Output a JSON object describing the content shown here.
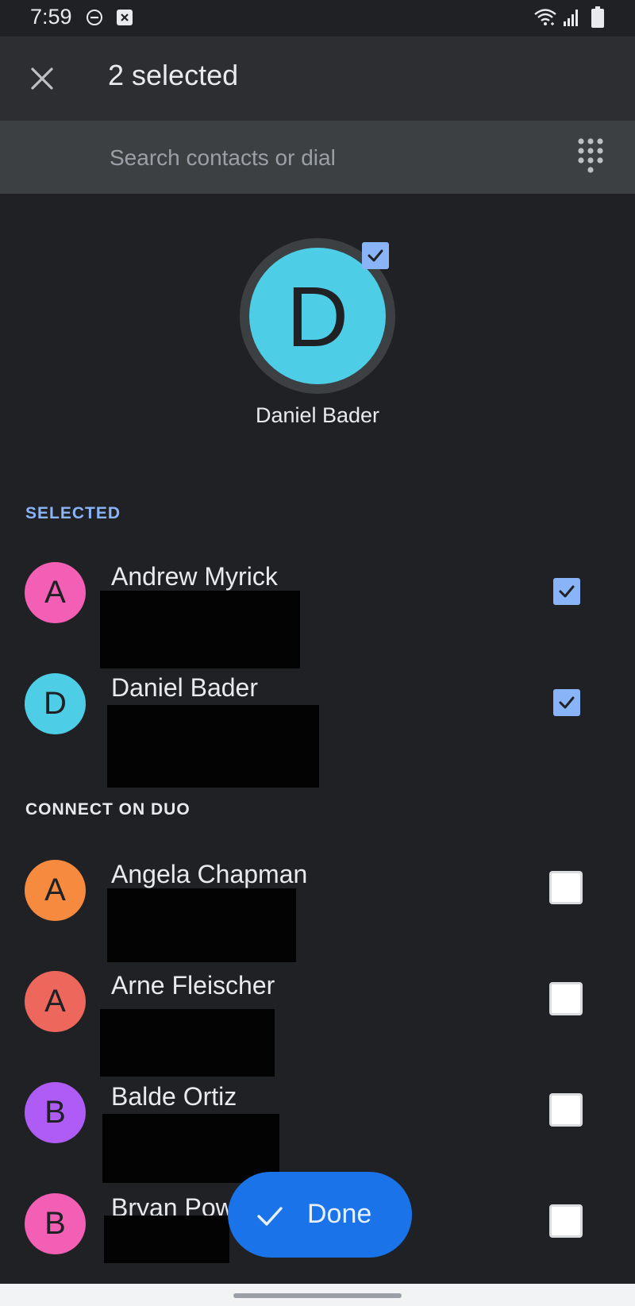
{
  "status_bar": {
    "time": "7:59",
    "icons": [
      "do-not-disturb-icon",
      "notification-icon",
      "wifi-icon",
      "signal-icon",
      "battery-icon"
    ]
  },
  "app_bar": {
    "title": "2 selected",
    "close_icon": "close-icon"
  },
  "search": {
    "placeholder": "Search contacts or dial",
    "dialpad_icon": "dialpad-icon"
  },
  "hero": {
    "initial": "D",
    "name": "Daniel Bader",
    "color": "#4ecde6",
    "checked": true
  },
  "sections": {
    "selected": "SELECTED",
    "connect_on_duo": "CONNECT ON DUO"
  },
  "selected_contacts": [
    {
      "initial": "A",
      "name": "Andrew Myrick",
      "color": "#f25fb4",
      "checked": true
    },
    {
      "initial": "D",
      "name": "Daniel Bader",
      "color": "#4ecde6",
      "checked": true
    }
  ],
  "duo_contacts": [
    {
      "initial": "A",
      "name": "Angela Chapman",
      "color": "#f68b3f",
      "checked": false
    },
    {
      "initial": "A",
      "name": "Arne Fleischer",
      "color": "#ee675c",
      "checked": false
    },
    {
      "initial": "B",
      "name": "Balde Ortiz",
      "color": "#af5cf7",
      "checked": false
    },
    {
      "initial": "B",
      "name": "Bryan Pow",
      "color": "#f25fb4",
      "checked": false
    }
  ],
  "fab": {
    "label": "Done",
    "icon": "check-icon",
    "color": "#1a73e8"
  },
  "colors": {
    "background": "#202124",
    "accent": "#8ab4f8"
  }
}
